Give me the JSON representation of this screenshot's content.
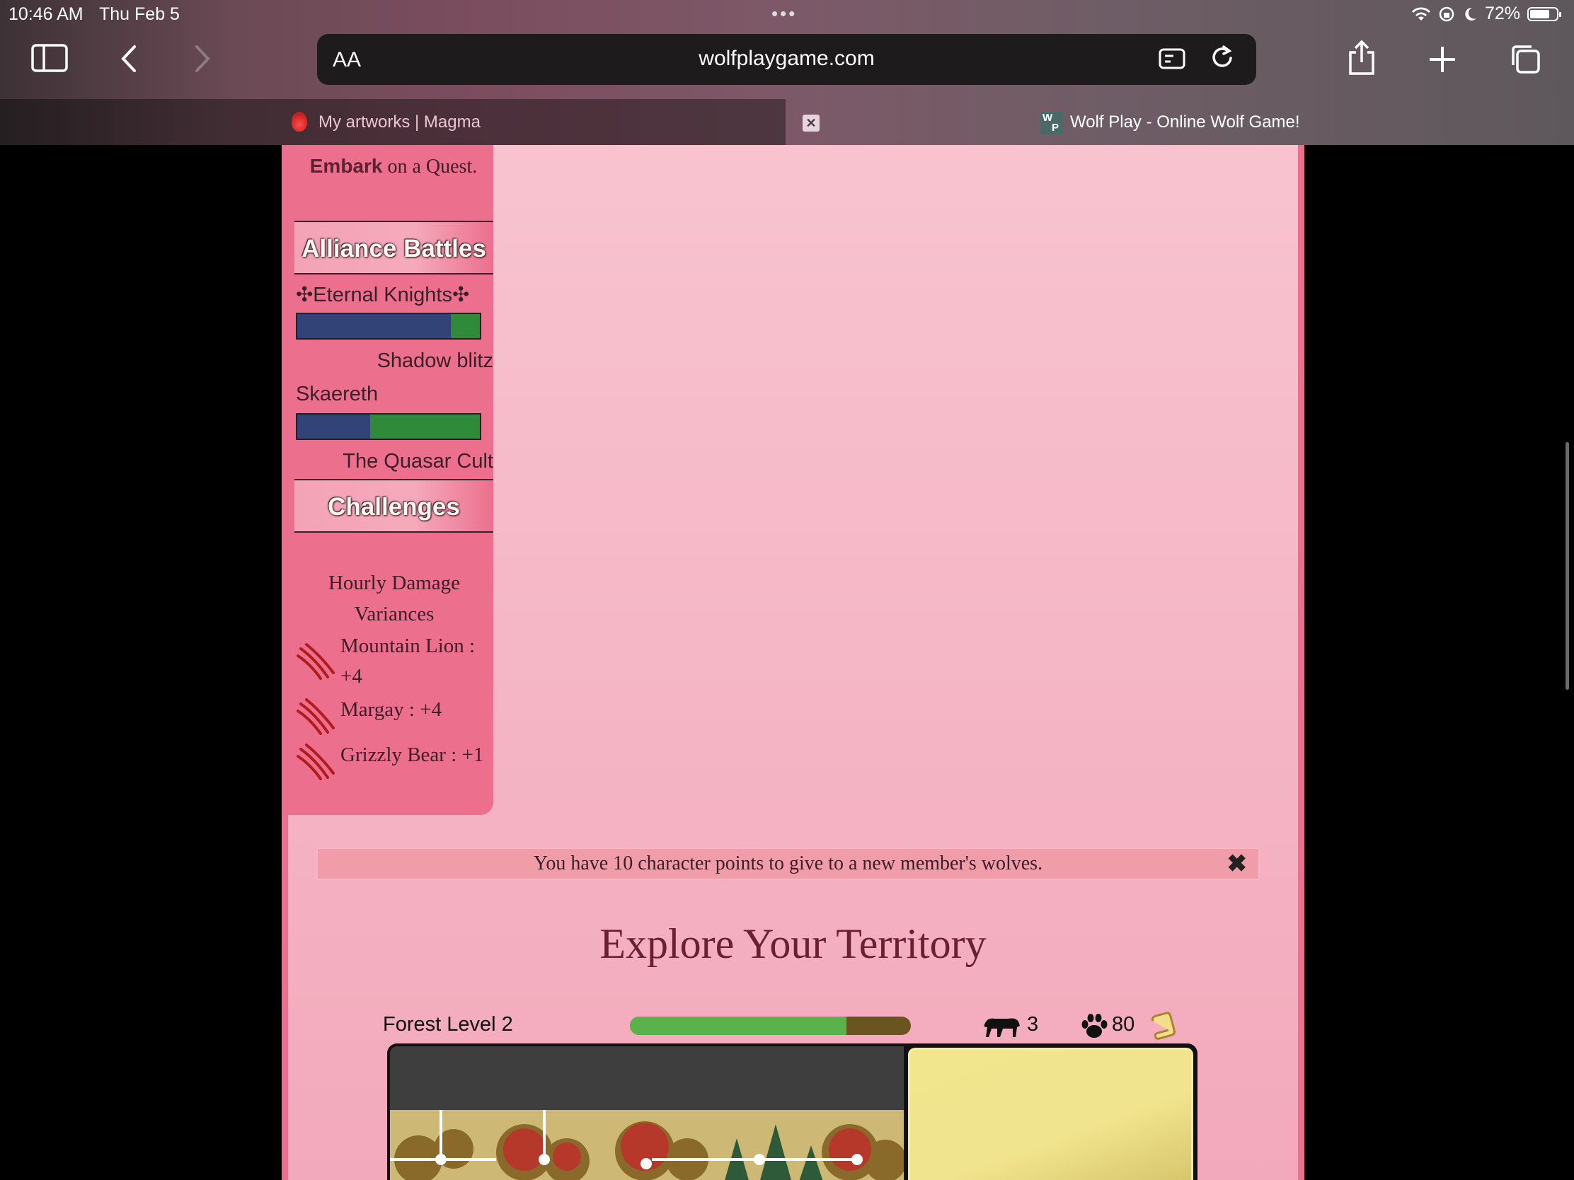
{
  "status_bar": {
    "time": "10:46 AM",
    "date": "Thu Feb 5",
    "battery": "72%"
  },
  "browser": {
    "url": "wolfplaygame.com",
    "text_size_label": "AA",
    "tabs": [
      {
        "title": "My artworks | Magma",
        "active": false
      },
      {
        "title": "Wolf Play - Online Wolf Game!",
        "active": true
      }
    ]
  },
  "sidebar": {
    "embark_bold": "Embark",
    "embark_rest": " on a Quest.",
    "alliance_heading": "Alliance Battles",
    "battles": [
      {
        "team_a": "✣Eternal Knights✣",
        "team_b": "Shadow blitz",
        "team_a_fraction": 0.84
      },
      {
        "team_a": "Skaereth",
        "team_b": "The Quasar Cult",
        "team_a_fraction": 0.4
      }
    ],
    "challenges_heading": "Challenges",
    "variances_title": "Hourly Damage Variances",
    "variances": [
      {
        "text": "Mountain Lion : +4"
      },
      {
        "text": "Margay : +4"
      },
      {
        "text": "Grizzly Bear : +1"
      }
    ]
  },
  "notice": {
    "text": "You have 10 character points to give to a new member's wolves."
  },
  "explore": {
    "title": "Explore Your Territory",
    "forest_label": "Forest Level 2",
    "progress_fraction": 0.77,
    "enemy_count": "3",
    "paw_count": "80"
  },
  "colors": {
    "page_bg": "#f8c3cf",
    "sidebar": "#ec6f8e",
    "team_a_bar": "#324477",
    "team_b_bar": "#2f8a3a",
    "xp_fill": "#5cb24a",
    "title_color": "#6b1f33"
  }
}
